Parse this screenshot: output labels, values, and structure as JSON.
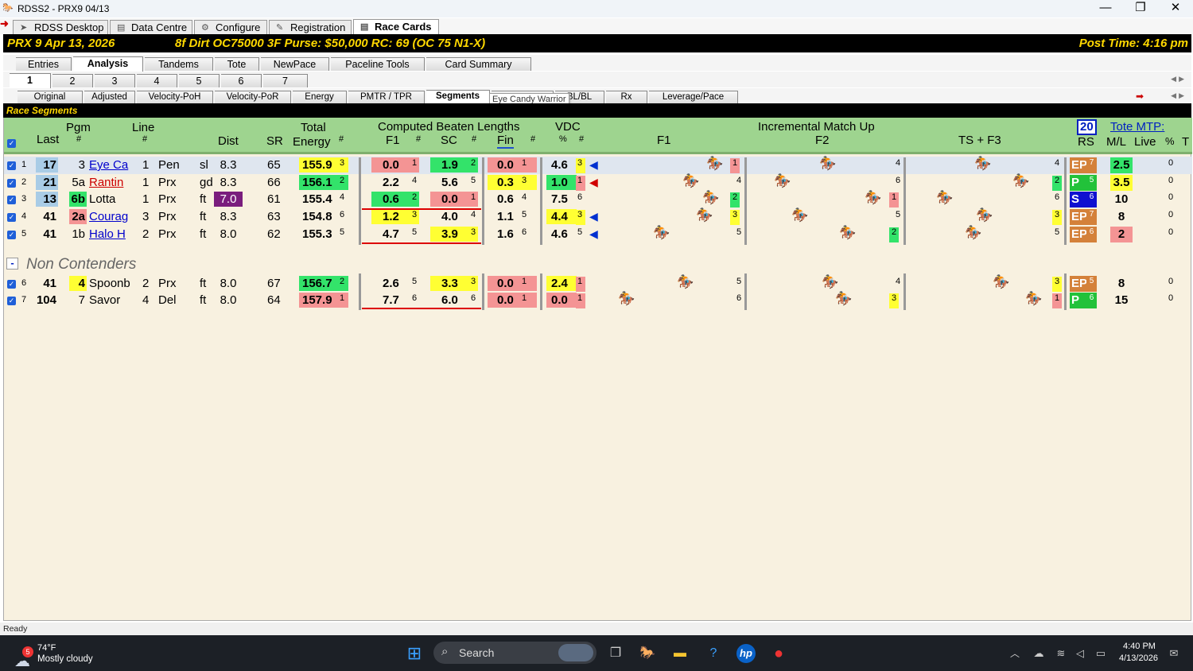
{
  "window": {
    "title": "RDSS2 - PRX9  04/13",
    "controls": [
      "—",
      "❐",
      "✕"
    ]
  },
  "main_tabs": [
    {
      "label": "RDSS Desktop",
      "icon": "➤"
    },
    {
      "label": "Data Centre",
      "icon": "▤"
    },
    {
      "label": "Configure",
      "icon": "⚙"
    },
    {
      "label": "Registration",
      "icon": "✎"
    },
    {
      "label": "Race Cards",
      "icon": "▤",
      "active": true
    }
  ],
  "race": {
    "left": "PRX  9   Apr 13, 2026",
    "mid": "8f  Dirt   OC75000  3F   Purse: $50,000   RC: 69  (OC 75 N1-X)",
    "right": "Post Time: 4:16 pm"
  },
  "sub_tabs": [
    "Entries",
    "Analysis",
    "Tandems",
    "Tote",
    "NewPace",
    "Paceline Tools",
    "Card Summary"
  ],
  "num_tabs": [
    "1",
    "2",
    "3",
    "4",
    "5",
    "6",
    "7"
  ],
  "view_tabs": [
    "Original",
    "Adjusted",
    "Velocity-PoH",
    "Velocity-PoR",
    "Energy",
    "PMTR / TPR",
    "Segments",
    "",
    "BL/BL",
    "Rx",
    "Leverage/Pace"
  ],
  "tooltip": "Eye Candy Warrior",
  "section_title": "Race Segments",
  "headers": {
    "pgm": "Pgm",
    "pgm_num": "#",
    "last": "Last",
    "line": "Line",
    "line_num": "#",
    "dist": "Dist",
    "sr": "SR",
    "total": "Total",
    "energy": "Energy",
    "energy_num": "#",
    "cbl": "Computed Beaten Lengths",
    "f1": "F1",
    "f1_num": "#",
    "sc": "SC",
    "sc_num": "#",
    "fin": "Fin",
    "fin_num": "#",
    "vdc": "VDC",
    "vdc_pct": "%",
    "vdc_num": "#",
    "imu": "Incremental Match Up",
    "imu_f1": "F1",
    "imu_f2": "F2",
    "imu_ts": "TS + F3",
    "mtp_box": "20",
    "tote_mtp": "Tote MTP:",
    "rs": "RS",
    "ml": "M/L",
    "live": "Live",
    "pct": "%",
    "t": "T"
  },
  "non_contenders_label": "Non Contenders",
  "non_contenders_toggle": "-",
  "rows": [
    {
      "n": "1",
      "last": "17",
      "pgm": "3",
      "name": "Eye Ca",
      "line": "1",
      "trk": "Pen",
      "cond": "sl",
      "dist": "8.3",
      "sr": "65",
      "energy": "155.9",
      "er": "3",
      "f1": "0.0",
      "f1r": "1",
      "sc": "1.9",
      "scr": "2",
      "fin": "0.0",
      "finr": "1",
      "vdc": "4.6",
      "vdcr": "3",
      "arrow": "◀",
      "imu1": "1",
      "imu2": "4",
      "imu3": "4",
      "rs": "EP",
      "rsn": "7",
      "ml": "2.5",
      "live": "0"
    },
    {
      "n": "2",
      "last": "21",
      "pgm": "5a",
      "name": "Rantin",
      "line": "1",
      "trk": "Prx",
      "cond": "gd",
      "dist": "8.3",
      "sr": "66",
      "energy": "156.1",
      "er": "2",
      "f1": "2.2",
      "f1r": "4",
      "sc": "5.6",
      "scr": "5",
      "fin": "0.3",
      "finr": "3",
      "vdc": "1.0",
      "vdcr": "1",
      "arrow": "◀",
      "imu1": "4",
      "imu2": "6",
      "imu3": "2",
      "rs": "P",
      "rsn": "5",
      "ml": "3.5",
      "live": "0"
    },
    {
      "n": "3",
      "last": "13",
      "pgm": "6b",
      "name": "Lotta",
      "line": "1",
      "trk": "Prx",
      "cond": "ft",
      "dist": "7.0",
      "sr": "61",
      "energy": "155.4",
      "er": "4",
      "f1": "0.6",
      "f1r": "2",
      "sc": "0.0",
      "scr": "1",
      "fin": "0.6",
      "finr": "4",
      "vdc": "7.5",
      "vdcr": "6",
      "arrow": "",
      "imu1": "2",
      "imu2": "1",
      "imu3": "6",
      "rs": "S",
      "rsn": "6",
      "ml": "10",
      "live": "0"
    },
    {
      "n": "4",
      "last": "41",
      "pgm": "2a",
      "name": "Courag",
      "line": "3",
      "trk": "Prx",
      "cond": "ft",
      "dist": "8.3",
      "sr": "63",
      "energy": "154.8",
      "er": "6",
      "f1": "1.2",
      "f1r": "3",
      "sc": "4.0",
      "scr": "4",
      "fin": "1.1",
      "finr": "5",
      "vdc": "4.4",
      "vdcr": "3",
      "arrow": "◀",
      "imu1": "3",
      "imu2": "5",
      "imu3": "3",
      "rs": "EP",
      "rsn": "7",
      "ml": "8",
      "live": "0"
    },
    {
      "n": "5",
      "last": "41",
      "pgm": "1b",
      "name": "Halo H",
      "line": "2",
      "trk": "Prx",
      "cond": "ft",
      "dist": "8.0",
      "sr": "62",
      "energy": "155.3",
      "er": "5",
      "f1": "4.7",
      "f1r": "5",
      "sc": "3.9",
      "scr": "3",
      "fin": "1.6",
      "finr": "6",
      "vdc": "4.6",
      "vdcr": "5",
      "arrow": "◀",
      "imu1": "5",
      "imu2": "2",
      "imu3": "5",
      "rs": "EP",
      "rsn": "6",
      "ml": "2",
      "live": "0"
    },
    {
      "n": "6",
      "last": "41",
      "pgm": "4",
      "name": "Spoonb",
      "line": "2",
      "trk": "Prx",
      "cond": "ft",
      "dist": "8.0",
      "sr": "67",
      "energy": "156.7",
      "er": "2",
      "f1": "2.6",
      "f1r": "5",
      "sc": "3.3",
      "scr": "3",
      "fin": "0.0",
      "finr": "1",
      "vdc": "2.4",
      "vdcr": "1",
      "arrow": "",
      "imu1": "5",
      "imu2": "4",
      "imu3": "3",
      "rs": "EP",
      "rsn": "5",
      "ml": "8",
      "live": "0"
    },
    {
      "n": "7",
      "last": "104",
      "pgm": "7",
      "name": "Savor",
      "line": "4",
      "trk": "Del",
      "cond": "ft",
      "dist": "8.0",
      "sr": "64",
      "energy": "157.9",
      "er": "1",
      "f1": "7.7",
      "f1r": "6",
      "sc": "6.0",
      "scr": "6",
      "fin": "0.0",
      "finr": "1",
      "vdc": "0.0",
      "vdcr": "1",
      "arrow": "",
      "imu1": "6",
      "imu2": "3",
      "imu3": "1",
      "rs": "P",
      "rsn": "6",
      "ml": "15",
      "live": "0"
    }
  ],
  "status": "Ready",
  "taskbar": {
    "badge": "5",
    "weather_temp": "74°F",
    "weather_desc": "Mostly cloudy",
    "search": "Search",
    "time": "4:40 PM",
    "date": "4/13/2026"
  },
  "colors": {
    "yellow": "#ffff33",
    "green": "#33e36a",
    "pink": "#f49494",
    "purple": "#7a1d7d",
    "ep": "#d4813a",
    "p": "#22c23a",
    "s": "#1010d0"
  }
}
